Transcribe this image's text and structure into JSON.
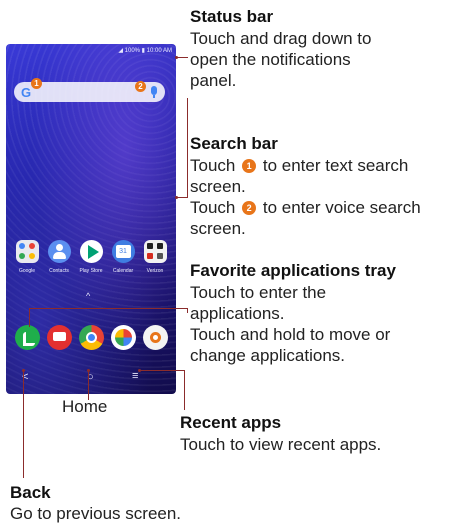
{
  "phone": {
    "status_text": "100% ▮ 10:00 AM",
    "search_g": "G",
    "badge_1": "1",
    "badge_2": "2",
    "up_arrow": "^",
    "home_apps": [
      {
        "name": "Google",
        "color": "#e9e9ef"
      },
      {
        "name": "Contacts",
        "color": "#5b8ff0"
      },
      {
        "name": "Play Store",
        "color": "#ffffff"
      },
      {
        "name": "Calendar",
        "color": "#3f7de2"
      },
      {
        "name": "Verizon",
        "color": "#f2f2f2"
      }
    ],
    "calendar_day": "31",
    "favorites": [
      {
        "icon": "phone-icon",
        "color": "#1fae4b"
      },
      {
        "icon": "messages-icon",
        "color": "#e33030"
      },
      {
        "icon": "chrome-icon",
        "color": "#ffffff"
      },
      {
        "icon": "photos-icon",
        "color": "#ffffff"
      },
      {
        "icon": "camera-icon",
        "color": "#f4f4f4"
      }
    ],
    "nav": {
      "back": "<",
      "home": "○",
      "recents": "≡"
    }
  },
  "callouts": {
    "status_bar": {
      "title": "Status bar",
      "body": "Touch and drag down to open the notifications panel."
    },
    "search_bar": {
      "title": "Search bar",
      "line1_pre": "Touch",
      "line1_badge": "❶",
      "line1_post": "to enter text search screen.",
      "line2_pre": "Touch",
      "line2_badge": "❷",
      "line2_post": "to enter voice search screen."
    },
    "favorites": {
      "title": "Favorite applications tray",
      "body1": "Touch to enter the applications.",
      "body2": "Touch and hold to move or change applications."
    },
    "home": {
      "title": "Home"
    },
    "recent_apps": {
      "title": "Recent apps",
      "body": "Touch to view recent apps."
    },
    "back": {
      "title": "Back",
      "body": "Go to previous screen."
    }
  },
  "colors": {
    "badge": "#e8751a",
    "leader": "#8b2c2c"
  }
}
